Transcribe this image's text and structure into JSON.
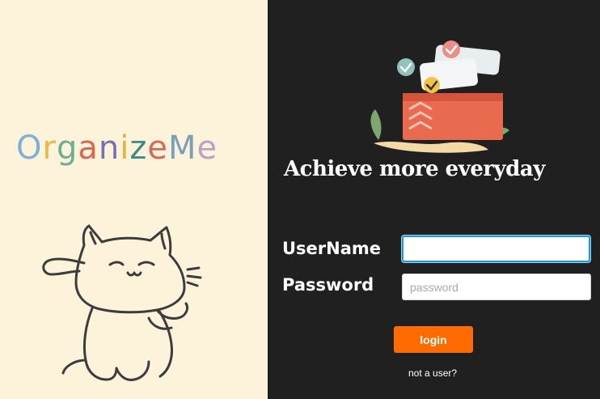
{
  "brand": {
    "name": "OrganizeMe",
    "letters": [
      {
        "ch": "O",
        "color": "#7fb0d6"
      },
      {
        "ch": "r",
        "color": "#e8b84a"
      },
      {
        "ch": "g",
        "color": "#6fae8f"
      },
      {
        "ch": "a",
        "color": "#d8674f"
      },
      {
        "ch": "n",
        "color": "#7a6fb0"
      },
      {
        "ch": "i",
        "color": "#e7b33f"
      },
      {
        "ch": "z",
        "color": "#3f8c86"
      },
      {
        "ch": "e",
        "color": "#d66a5a"
      },
      {
        "ch": "M",
        "color": "#7aa0b8"
      },
      {
        "ch": "e",
        "color": "#b9a2c8"
      }
    ]
  },
  "tagline": "Achieve more everyday",
  "form": {
    "username_label": "UserName",
    "username_value": "",
    "username_placeholder": "",
    "password_label": "Password",
    "password_placeholder": "password",
    "login_label": "login",
    "signup_link": "not a user?"
  },
  "colors": {
    "left_bg": "#fdf3db",
    "right_bg": "#202020",
    "accent": "#ff6b00",
    "focus": "#1a9ad6"
  },
  "icons": {
    "mascot": "cat-illustration-icon",
    "hero": "todo-box-illustration-icon"
  }
}
